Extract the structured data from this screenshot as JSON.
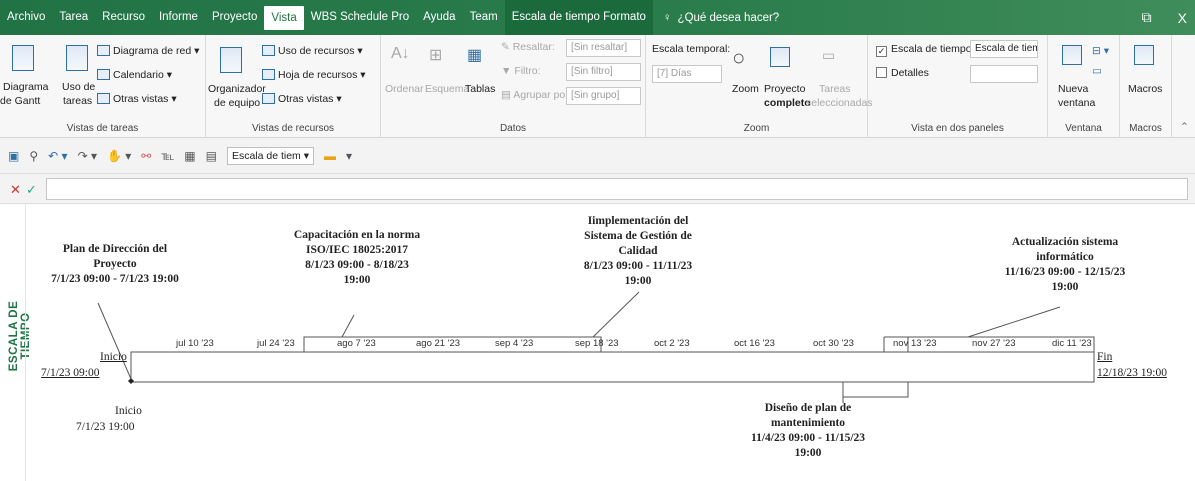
{
  "tabs": [
    "Archivo",
    "Tarea",
    "Recurso",
    "Informe",
    "Proyecto",
    "Vista",
    "WBS Schedule Pro",
    "Ayuda",
    "Team",
    "Escala de tiempo Formato"
  ],
  "active_tab": "Vista",
  "tell_me": "¿Qué desea hacer?",
  "window_controls": {
    "restore": "⧉",
    "close": "X"
  },
  "ribbon": {
    "vistas_tareas": {
      "label": "Vistas de tareas",
      "gantt_1": "Diagrama",
      "gantt_2": "de Gantt",
      "uso_1": "Uso de",
      "uso_2": "tareas",
      "red": "Diagrama de red",
      "calendario": "Calendario",
      "otras": "Otras vistas"
    },
    "vistas_recursos": {
      "label": "Vistas de recursos",
      "org_1": "Organizador",
      "org_2": "de equipo",
      "uso": "Uso de recursos",
      "hoja": "Hoja de recursos",
      "otras": "Otras vistas"
    },
    "datos": {
      "label": "Datos",
      "ordenar": "Ordenar",
      "esquema": "Esquema",
      "tablas": "Tablas",
      "resaltar": "Resaltar:",
      "filtro": "Filtro:",
      "agrupar": "Agrupar por:",
      "resaltar_val": "[Sin resaltar]",
      "filtro_val": "[Sin filtro]",
      "agrupar_val": "[Sin grupo]"
    },
    "zoom": {
      "label": "Zoom",
      "escala_temporal": "Escala temporal:",
      "escala_val": "[7] Días",
      "zoom": "Zoom",
      "proyecto_1": "Proyecto",
      "proyecto_2": "completo",
      "tareas_1": "Tareas",
      "tareas_2": "seleccionadas"
    },
    "dos_paneles": {
      "label": "Vista en dos paneles",
      "escala": "Escala de tiempo",
      "escala_val": "Escala de tiem",
      "detalles": "Detalles"
    },
    "ventana": {
      "label": "Ventana",
      "nueva_1": "Nueva",
      "nueva_2": "ventana"
    },
    "macros": {
      "label": "Macros",
      "macros": "Macros"
    }
  },
  "qat": {
    "combo": "Escala de tiem"
  },
  "timeline": {
    "side_label": "ESCALA DE TIEMPO",
    "start_label": "Inicio",
    "start_date": "7/1/23 09:00",
    "finish_label": "Fin",
    "finish_date": "12/18/23 19:00",
    "milestone_label": "Inicio",
    "milestone_date": "7/1/23 19:00",
    "ticks": [
      "jul 10 '23",
      "jul 24 '23",
      "ago 7 '23",
      "ago 21 '23",
      "sep 4 '23",
      "sep 18 '23",
      "oct 2 '23",
      "oct 16 '23",
      "oct 30 '23",
      "nov 13 '23",
      "nov 27 '23",
      "dic 11 '23"
    ],
    "callouts": [
      {
        "title_1": "Plan de Dirección del",
        "title_2": "Proyecto",
        "dates": "7/1/23 09:00 - 7/1/23 19:00"
      },
      {
        "title_1": "Capacitación en la norma",
        "title_2": "ISO/IEC 18025:2017",
        "dates_1": "8/1/23 09:00 - 8/18/23",
        "dates_2": "19:00"
      },
      {
        "title_1": "Iimplementación del",
        "title_2": "Sistema de Gestión de",
        "title_3": "Calidad",
        "dates_1": "8/1/23 09:00 - 11/11/23",
        "dates_2": "19:00"
      },
      {
        "title_1": "Actualización sistema",
        "title_2": "informático",
        "dates_1": "11/16/23 09:00 - 12/15/23",
        "dates_2": "19:00"
      },
      {
        "title_1": "Diseño de plan de",
        "title_2": "mantenimiento",
        "dates_1": "11/4/23 09:00 - 11/15/23",
        "dates_2": "19:00"
      }
    ]
  }
}
